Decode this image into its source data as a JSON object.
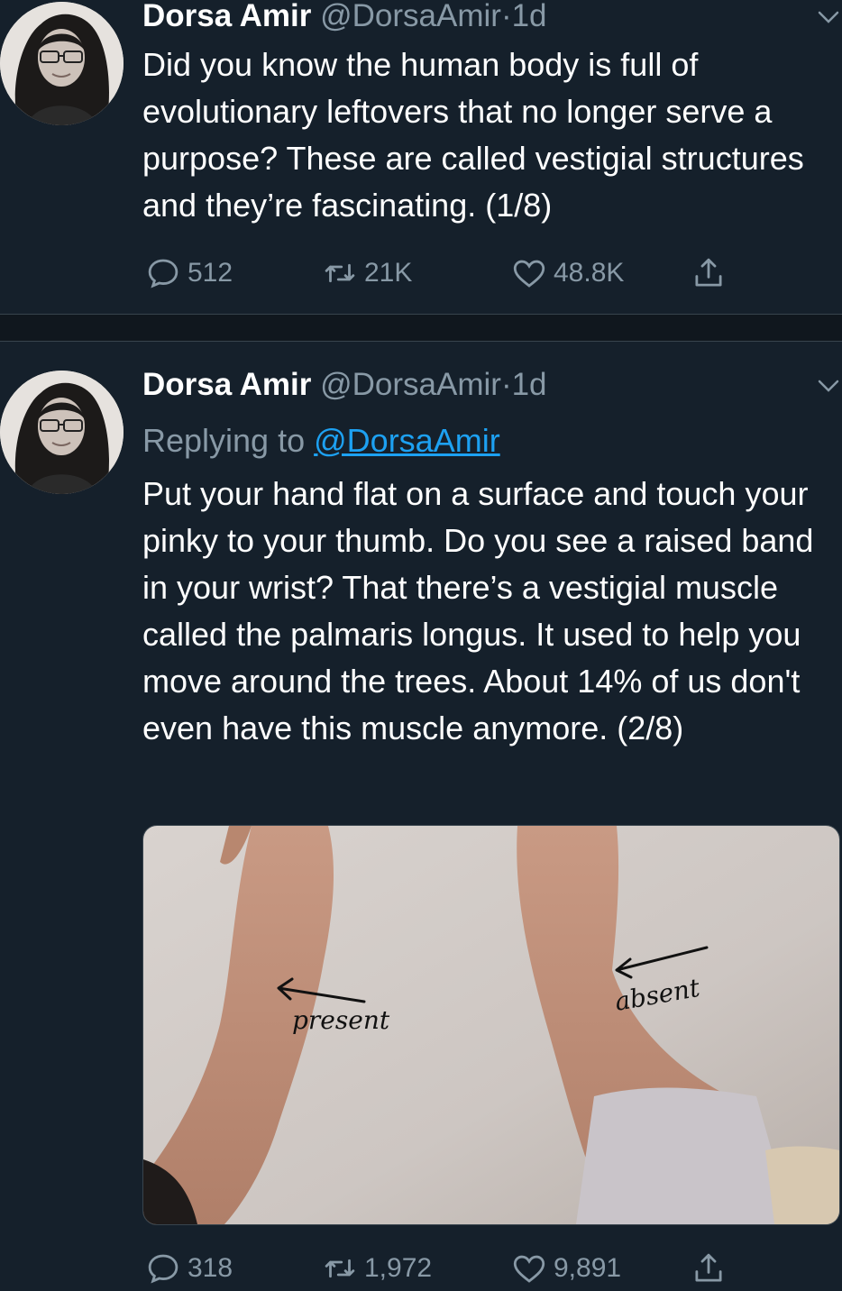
{
  "tweets": [
    {
      "author_name": "Dorsa Amir",
      "author_handle": "@DorsaAmir",
      "separator": "·",
      "time": "1d",
      "text": "Did you know the human body is full of evolutionary leftovers that no longer serve a purpose? These are called vestigial structures and they’re fascinating. (1/8)",
      "replies": "512",
      "retweets": "21K",
      "likes": "48.8K"
    },
    {
      "author_name": "Dorsa Amir",
      "author_handle": "@DorsaAmir",
      "separator": "·",
      "time": "1d",
      "replying_prefix": "Replying to",
      "replying_to": "@DorsaAmir",
      "text": "Put your hand flat on a surface and touch your pinky to your thumb. Do you see a raised band in your wrist? That there’s a vestigial muscle called the palmaris longus. It used to help you move around the trees. About 14% of us don't even have this muscle anymore. (2/8)",
      "media": {
        "label_left": "present",
        "label_right": "absent"
      },
      "replies": "318",
      "retweets": "1,972",
      "likes": "9,891"
    }
  ],
  "icons": [
    "reply-icon",
    "retweet-icon",
    "like-icon",
    "share-icon",
    "chevron-down-icon"
  ],
  "colors": {
    "background": "#15202b",
    "secondary_text": "#8899a6",
    "link": "#1da1f2",
    "divider": "#10171e"
  }
}
